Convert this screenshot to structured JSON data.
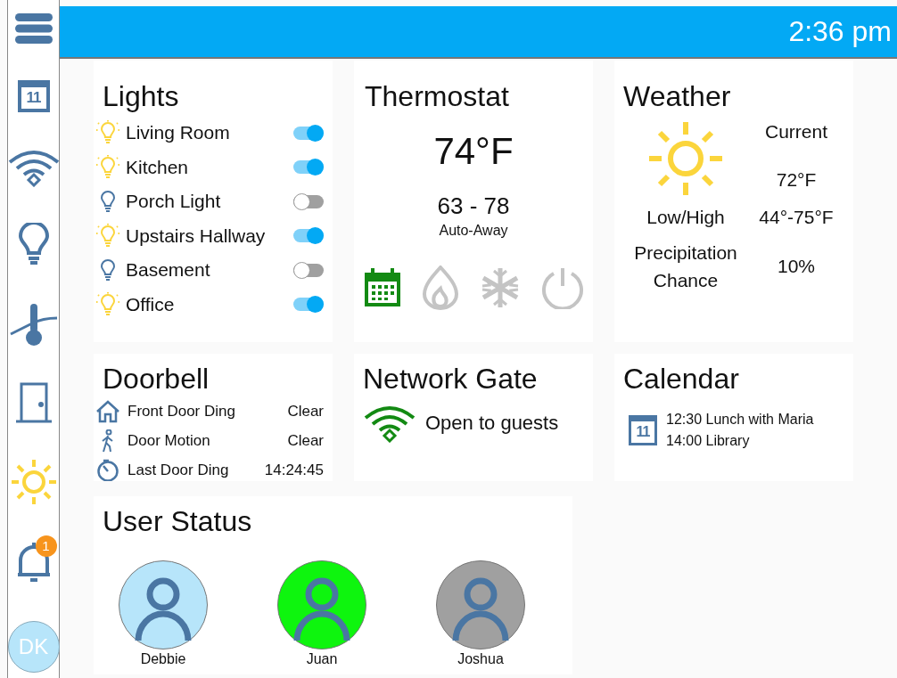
{
  "time": "2:36 pm",
  "sidebar": [
    {
      "kind": "menu"
    },
    {
      "kind": "calendar",
      "day": "11"
    },
    {
      "kind": "wifi"
    },
    {
      "kind": "bulb"
    },
    {
      "kind": "thermometer"
    },
    {
      "kind": "door"
    },
    {
      "kind": "sun"
    },
    {
      "kind": "bell",
      "badge": "1"
    },
    {
      "kind": "avatar",
      "initials": "DK"
    }
  ],
  "lights": {
    "title": "Lights",
    "items": [
      {
        "name": "Living Room",
        "on": true
      },
      {
        "name": "Kitchen",
        "on": true
      },
      {
        "name": "Porch Light",
        "on": false
      },
      {
        "name": "Upstairs Hallway",
        "on": true
      },
      {
        "name": "Basement",
        "on": false
      },
      {
        "name": "Office",
        "on": true
      }
    ]
  },
  "thermostat": {
    "title": "Thermostat",
    "temperature": "74°F",
    "range": "63 - 78",
    "mode_label": "Auto-Away",
    "modes": [
      {
        "kind": "schedule",
        "selected": true
      },
      {
        "kind": "heat",
        "selected": false
      },
      {
        "kind": "cool",
        "selected": false
      },
      {
        "kind": "power",
        "selected": false
      }
    ]
  },
  "weather": {
    "title": "Weather",
    "current_label": "Current",
    "current": "72°F",
    "rows": [
      {
        "label": "Low/High",
        "value": "44°-75°F"
      },
      {
        "label": "Precipitation Chance",
        "value": "10%"
      }
    ]
  },
  "doorbell": {
    "title": "Doorbell",
    "rows": [
      {
        "kind": "home",
        "label": "Front Door Ding",
        "value": "Clear"
      },
      {
        "kind": "walk",
        "label": "Door Motion",
        "value": "Clear"
      },
      {
        "kind": "timer",
        "label": "Last Door Ding",
        "value": "14:24:45"
      }
    ]
  },
  "network": {
    "title": "Network Gate",
    "status": "Open to guests"
  },
  "calendar": {
    "title": "Calendar",
    "day": "11",
    "events": [
      "12:30 Lunch with Maria",
      "14:00 Library"
    ]
  },
  "users": {
    "title": "User Status",
    "items": [
      {
        "name": "Debbie",
        "color": "#b7e5fa"
      },
      {
        "name": "Juan",
        "color": "#0ef50e"
      },
      {
        "name": "Joshua",
        "color": "#a0a0a0"
      }
    ]
  }
}
